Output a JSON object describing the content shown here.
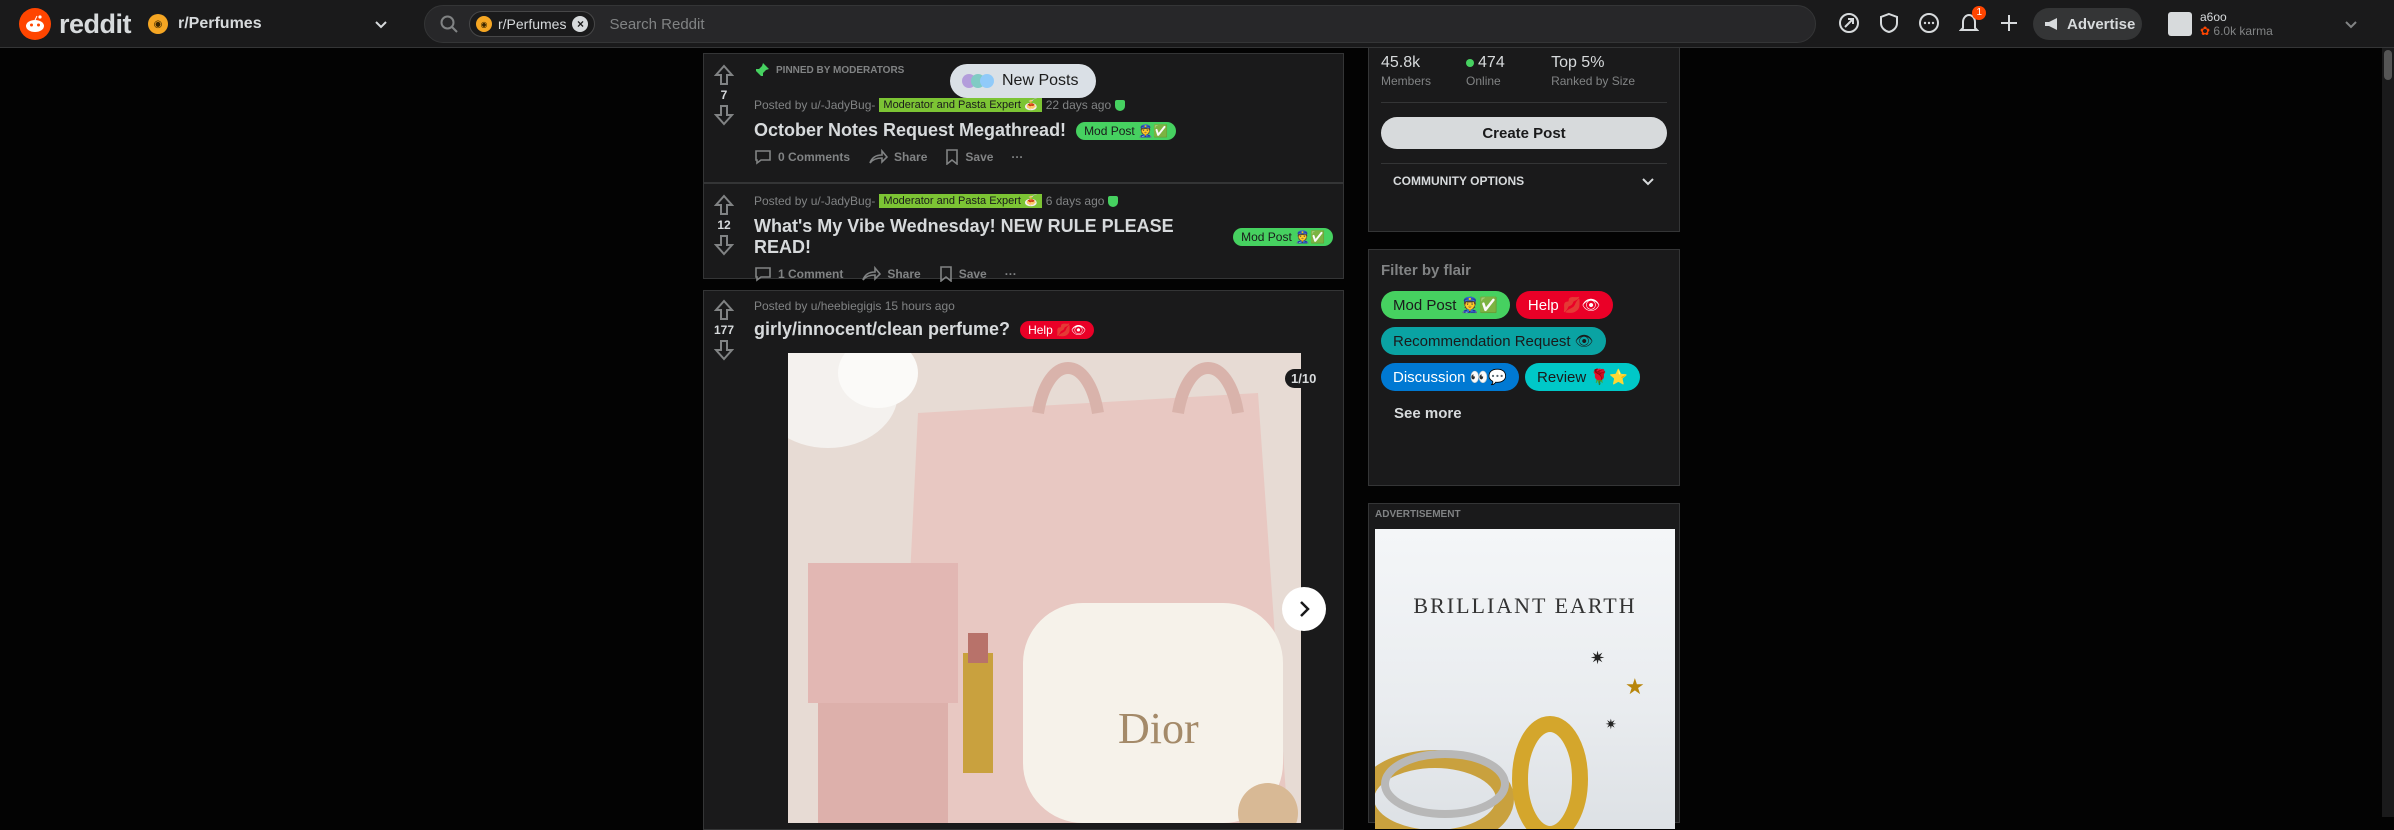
{
  "header": {
    "logo_text": "reddit",
    "community": "r/Perfumes",
    "search_chip": "r/Perfumes",
    "search_placeholder": "Search Reddit",
    "notif_count": "1",
    "advertise_label": "Advertise",
    "username": "a6oo",
    "karma": "6.0k karma"
  },
  "new_posts_label": "New Posts",
  "pinned_label": "PINNED BY MODERATORS",
  "posts": [
    {
      "votes": "7",
      "author": "Posted by u/-JadyBug-",
      "user_flair": "Moderator and Pasta Expert 🍝",
      "time": "22 days ago",
      "title": "October Notes Request Megathread!",
      "flair": "Mod Post 👮✅",
      "comments": "0 Comments",
      "share": "Share",
      "save": "Save",
      "more": "···"
    },
    {
      "votes": "12",
      "author": "Posted by u/-JadyBug-",
      "user_flair": "Moderator and Pasta Expert 🍝",
      "time": "6 days ago",
      "title": "What's My Vibe Wednesday! NEW RULE PLEASE READ!",
      "flair": "Mod Post 👮✅",
      "comments": "1 Comment",
      "share": "Share",
      "save": "Save",
      "more": "···"
    },
    {
      "votes": "177",
      "author": "Posted by u/heebiegigis 15 hours ago",
      "title": "girly/innocent/clean perfume?",
      "flair": "Help 💋👁",
      "gallery_count": "1/10"
    }
  ],
  "sidebar": {
    "members_value": "45.8k",
    "members_label": "Members",
    "online_value": "474",
    "online_label": "Online",
    "rank_value": "Top 5%",
    "rank_label": "Ranked by Size",
    "create_post": "Create Post",
    "community_options": "COMMUNITY OPTIONS",
    "filter_title": "Filter by flair",
    "flairs": [
      "Mod Post 👮✅",
      "Help 💋👁",
      "Recommendation Request 👁",
      "Discussion 👀💬",
      "Review 🌹⭐"
    ],
    "see_more": "See more",
    "ad_label": "ADVERTISEMENT",
    "ad_brand": "BRILLIANT EARTH"
  },
  "colors": {
    "accent": "#ff4500",
    "mod_green": "#46d160",
    "help_red": "#ea0027",
    "discussion_blue": "#0079d3",
    "teal": "#0aa3a3"
  }
}
